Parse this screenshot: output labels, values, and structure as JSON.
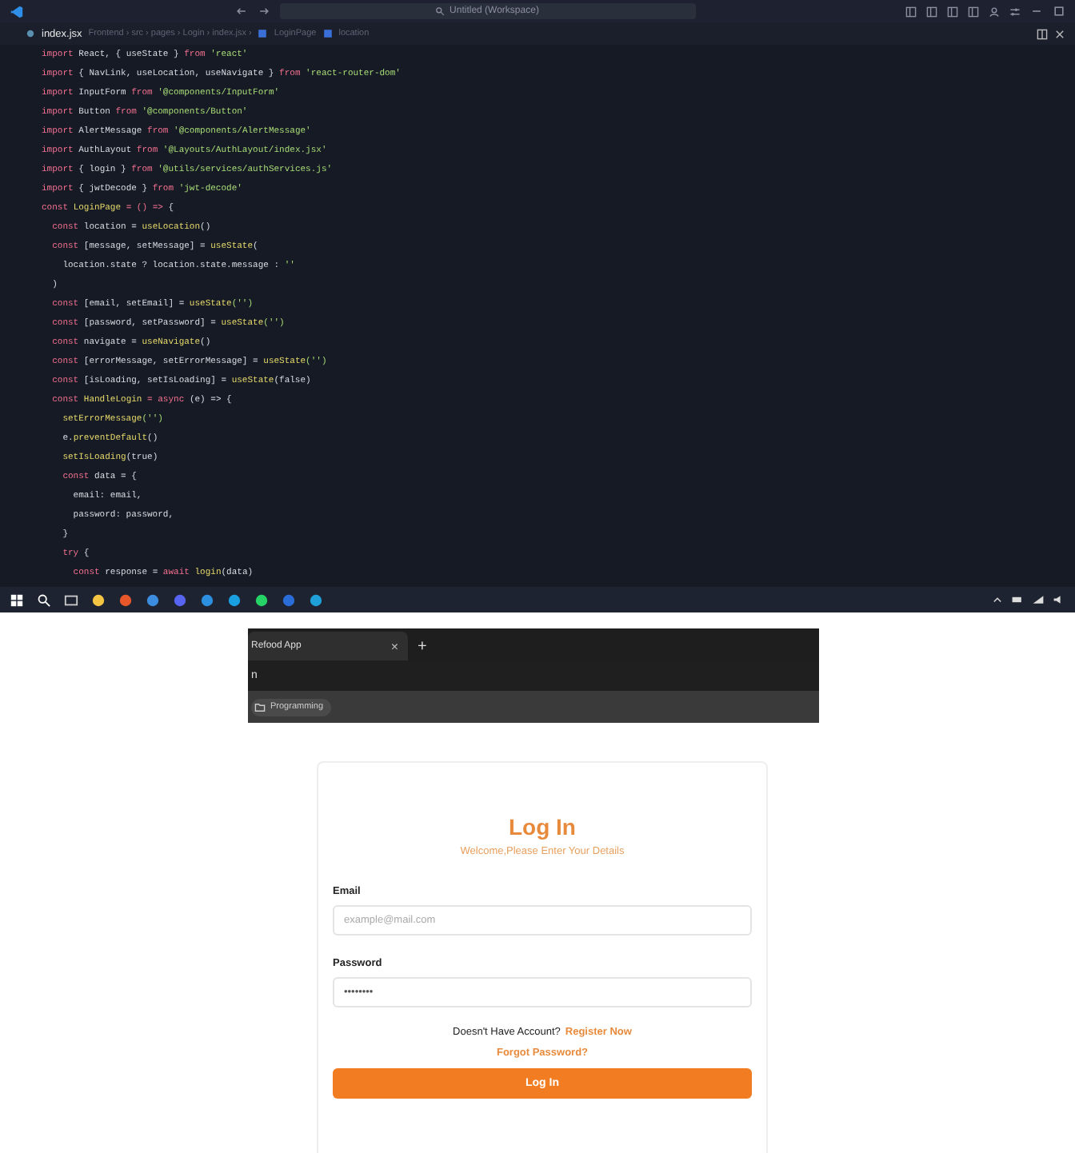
{
  "editor": {
    "title_search": "Untitled (Workspace)",
    "tab": {
      "file": "index.jsx",
      "path": "Frontend › src › pages › Login › index.jsx ›",
      "symbols": [
        "LoginPage",
        "location"
      ]
    },
    "lines": [
      [
        {
          "kind": "keyword",
          "text": "import"
        },
        {
          "kind": "plain",
          "text": " React, { useState } "
        },
        {
          "kind": "keyword",
          "text": "from"
        },
        {
          "kind": "string",
          "text": " 'react'"
        }
      ],
      [
        {
          "kind": "keyword",
          "text": "import"
        },
        {
          "kind": "plain",
          "text": " { NavLink, useLocation, useNavigate } "
        },
        {
          "kind": "keyword",
          "text": "from"
        },
        {
          "kind": "string",
          "text": " 'react-router-dom'"
        }
      ],
      [
        {
          "kind": "keyword",
          "text": "import"
        },
        {
          "kind": "plain",
          "text": " InputForm "
        },
        {
          "kind": "keyword",
          "text": "from"
        },
        {
          "kind": "string",
          "text": " '@components/InputForm'"
        }
      ],
      [
        {
          "kind": "keyword",
          "text": "import"
        },
        {
          "kind": "plain",
          "text": " Button "
        },
        {
          "kind": "keyword",
          "text": "from"
        },
        {
          "kind": "string",
          "text": " '@components/Button'"
        }
      ],
      [
        {
          "kind": "keyword",
          "text": "import"
        },
        {
          "kind": "plain",
          "text": " AlertMessage "
        },
        {
          "kind": "keyword",
          "text": "from"
        },
        {
          "kind": "string",
          "text": " '@components/AlertMessage'"
        }
      ],
      [
        {
          "kind": "keyword",
          "text": "import"
        },
        {
          "kind": "plain",
          "text": " AuthLayout "
        },
        {
          "kind": "keyword",
          "text": "from"
        },
        {
          "kind": "string",
          "text": " '@Layouts/AuthLayout/index.jsx'"
        }
      ],
      [
        {
          "kind": "keyword",
          "text": "import"
        },
        {
          "kind": "plain",
          "text": " { login } "
        },
        {
          "kind": "keyword",
          "text": "from"
        },
        {
          "kind": "string",
          "text": " '@utils/services/authServices.js'"
        }
      ],
      [
        {
          "kind": "keyword",
          "text": "import"
        },
        {
          "kind": "plain",
          "text": " { jwtDecode } "
        },
        {
          "kind": "keyword",
          "text": "from"
        },
        {
          "kind": "string",
          "text": " 'jwt-decode'"
        }
      ],
      [
        {
          "kind": "keyword",
          "text": "const"
        },
        {
          "kind": "function",
          "text": " LoginPage"
        },
        {
          "kind": "keyword",
          "text": " = () => "
        },
        {
          "kind": "plain",
          "text": "{"
        }
      ],
      [
        {
          "kind": "keyword",
          "text": "  const"
        },
        {
          "kind": "plain",
          "text": " location = "
        },
        {
          "kind": "function",
          "text": "useLocation"
        },
        {
          "kind": "plain",
          "text": "()"
        }
      ],
      [
        {
          "kind": "keyword",
          "text": "  const"
        },
        {
          "kind": "plain",
          "text": " [message, setMessage] = "
        },
        {
          "kind": "function",
          "text": "useState"
        },
        {
          "kind": "plain",
          "text": "("
        }
      ],
      [
        {
          "kind": "plain",
          "text": "    location.state ? location.state.message : "
        },
        {
          "kind": "string",
          "text": "''"
        }
      ],
      [
        {
          "kind": "plain",
          "text": "  )"
        }
      ],
      [
        {
          "kind": "keyword",
          "text": "  const"
        },
        {
          "kind": "plain",
          "text": " [email, setEmail] = "
        },
        {
          "kind": "function",
          "text": "useState"
        },
        {
          "kind": "string",
          "text": "('')"
        }
      ],
      [
        {
          "kind": "keyword",
          "text": "  const"
        },
        {
          "kind": "plain",
          "text": " [password, setPassword] = "
        },
        {
          "kind": "function",
          "text": "useState"
        },
        {
          "kind": "string",
          "text": "('')"
        }
      ],
      [
        {
          "kind": "keyword",
          "text": "  const"
        },
        {
          "kind": "plain",
          "text": " navigate = "
        },
        {
          "kind": "function",
          "text": "useNavigate"
        },
        {
          "kind": "plain",
          "text": "()"
        }
      ],
      [
        {
          "kind": "keyword",
          "text": "  const"
        },
        {
          "kind": "plain",
          "text": " [errorMessage, setErrorMessage] = "
        },
        {
          "kind": "function",
          "text": "useState"
        },
        {
          "kind": "string",
          "text": "('')"
        }
      ],
      [
        {
          "kind": "keyword",
          "text": "  const"
        },
        {
          "kind": "plain",
          "text": " [isLoading, setIsLoading] = "
        },
        {
          "kind": "function",
          "text": "useState"
        },
        {
          "kind": "plain",
          "text": "(false)"
        }
      ],
      [
        {
          "kind": "keyword",
          "text": "  const"
        },
        {
          "kind": "function",
          "text": " HandleLogin"
        },
        {
          "kind": "keyword",
          "text": " = async "
        },
        {
          "kind": "plain",
          "text": "(e) => {"
        }
      ],
      [
        {
          "kind": "function",
          "text": "    setErrorMessage"
        },
        {
          "kind": "string",
          "text": "('')"
        }
      ],
      [
        {
          "kind": "plain",
          "text": "    e."
        },
        {
          "kind": "function",
          "text": "preventDefault"
        },
        {
          "kind": "plain",
          "text": "()"
        }
      ],
      [
        {
          "kind": "function",
          "text": "    setIsLoading"
        },
        {
          "kind": "plain",
          "text": "(true)"
        }
      ],
      [
        {
          "kind": "keyword",
          "text": "    const"
        },
        {
          "kind": "plain",
          "text": " data = {"
        }
      ],
      [
        {
          "kind": "plain",
          "text": "      email: email,"
        }
      ],
      [
        {
          "kind": "plain",
          "text": "      password: password,"
        }
      ],
      [
        {
          "kind": "plain",
          "text": "    }"
        }
      ],
      [
        {
          "kind": "keyword",
          "text": "    try"
        },
        {
          "kind": "plain",
          "text": " {"
        }
      ],
      [
        {
          "kind": "keyword",
          "text": "      const"
        },
        {
          "kind": "plain",
          "text": " response = "
        },
        {
          "kind": "keyword",
          "text": "await"
        },
        {
          "kind": "function",
          "text": " login"
        },
        {
          "kind": "plain",
          "text": "(data)"
        }
      ]
    ]
  },
  "browser": {
    "tab": {
      "title": "Refood App",
      "close": "×"
    },
    "new_tab": "+",
    "address": "n",
    "bookmarks": [
      "Programming"
    ]
  },
  "login": {
    "title": "Log In",
    "subtitle": "Welcome,Please Enter Your Details",
    "fields": [
      {
        "label": "Email",
        "placeholder": "example@mail.com"
      },
      {
        "label": "Password",
        "value": "••••••••"
      }
    ],
    "account_prompt": "Doesn't Have Account?",
    "register_link": "Register Now",
    "forgot_link": "Forgot Password?",
    "submit": "Log In"
  }
}
